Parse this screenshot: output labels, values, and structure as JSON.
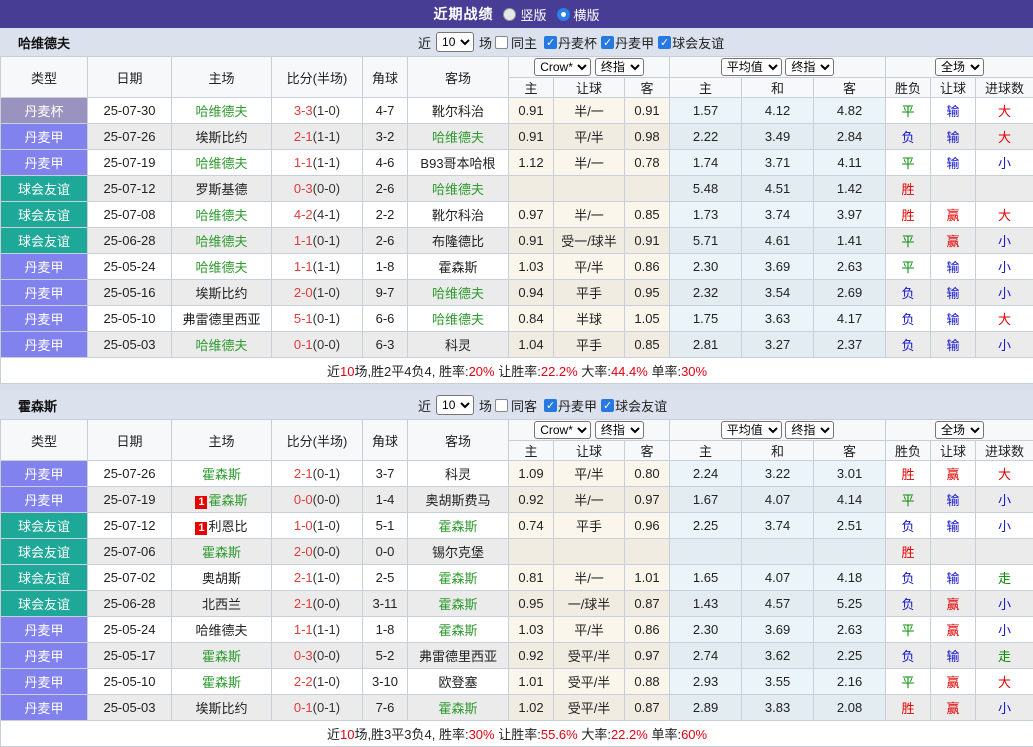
{
  "palette": {
    "topbar_bg": "#483d94",
    "team_bar_bg": "#dbe2ee",
    "type_colors": {
      "丹麦杯": "#9a93c0",
      "丹麦甲": "#8282ee",
      "球会友谊": "#1ea898"
    },
    "focus_team_green": "#2e9b2e",
    "score_red": "#e23b3b",
    "result_colors": {
      "胜": "#e60000",
      "平": "#028b02",
      "负": "#1414cc",
      "赢": "#e60000",
      "输": "#1414cc",
      "走": "#028b02",
      "大": "#e60000",
      "小": "#1414cc"
    }
  },
  "header": {
    "title": "近期战绩",
    "radios": [
      {
        "label": "竖版",
        "checked": false
      },
      {
        "label": "横版",
        "checked": true
      }
    ]
  },
  "columns": {
    "left": [
      "类型",
      "日期",
      "主场",
      "比分(半场)",
      "角球",
      "客场"
    ],
    "odds_group": {
      "select1": "Crow*",
      "select2": "终指",
      "subs": [
        "主",
        "让球",
        "客"
      ]
    },
    "avg_group": {
      "select1": "平均值",
      "select2": "终指",
      "subs": [
        "主",
        "和",
        "客"
      ]
    },
    "result_group": {
      "select": "全场",
      "subs": [
        "胜负",
        "让球",
        "进球数"
      ]
    }
  },
  "tables": [
    {
      "team": "哈维德夫",
      "filter": {
        "prefix": "近",
        "count": "10",
        "suffix": "场",
        "same_label": "同主",
        "same_checked": false,
        "leagues": [
          "丹麦杯",
          "丹麦甲",
          "球会友谊"
        ]
      },
      "rows": [
        {
          "type": "丹麦杯",
          "date": "25-07-30",
          "home": "哈维德夫",
          "home_focus": true,
          "home_badge": "",
          "score": "3-3",
          "half": "(1-0)",
          "corners": "4-7",
          "away": "靴尔科治",
          "away_focus": false,
          "away_badge": "",
          "odds": [
            "0.91",
            "半/一",
            "0.91"
          ],
          "avg": [
            "1.57",
            "4.12",
            "4.82"
          ],
          "results": [
            "平",
            "输",
            "大"
          ]
        },
        {
          "type": "丹麦甲",
          "date": "25-07-26",
          "home": "埃斯比约",
          "home_focus": false,
          "home_badge": "",
          "score": "2-1",
          "half": "(1-1)",
          "corners": "3-2",
          "away": "哈维德夫",
          "away_focus": true,
          "away_badge": "",
          "odds": [
            "0.91",
            "平/半",
            "0.98"
          ],
          "avg": [
            "2.22",
            "3.49",
            "2.84"
          ],
          "results": [
            "负",
            "输",
            "大"
          ]
        },
        {
          "type": "丹麦甲",
          "date": "25-07-19",
          "home": "哈维德夫",
          "home_focus": true,
          "home_badge": "",
          "score": "1-1",
          "half": "(1-1)",
          "corners": "4-6",
          "away": "B93哥本哈根",
          "away_focus": false,
          "away_badge": "",
          "odds": [
            "1.12",
            "半/一",
            "0.78"
          ],
          "avg": [
            "1.74",
            "3.71",
            "4.11"
          ],
          "results": [
            "平",
            "输",
            "小"
          ]
        },
        {
          "type": "球会友谊",
          "date": "25-07-12",
          "home": "罗斯基德",
          "home_focus": false,
          "home_badge": "",
          "score": "0-3",
          "half": "(0-0)",
          "corners": "2-6",
          "away": "哈维德夫",
          "away_focus": true,
          "away_badge": "",
          "odds": [
            "",
            "",
            ""
          ],
          "avg": [
            "5.48",
            "4.51",
            "1.42"
          ],
          "results": [
            "胜",
            "",
            ""
          ]
        },
        {
          "type": "球会友谊",
          "date": "25-07-08",
          "home": "哈维德夫",
          "home_focus": true,
          "home_badge": "",
          "score": "4-2",
          "half": "(4-1)",
          "corners": "2-2",
          "away": "靴尔科治",
          "away_focus": false,
          "away_badge": "",
          "odds": [
            "0.97",
            "半/一",
            "0.85"
          ],
          "avg": [
            "1.73",
            "3.74",
            "3.97"
          ],
          "results": [
            "胜",
            "赢",
            "大"
          ]
        },
        {
          "type": "球会友谊",
          "date": "25-06-28",
          "home": "哈维德夫",
          "home_focus": true,
          "home_badge": "",
          "score": "1-1",
          "half": "(0-1)",
          "corners": "2-6",
          "away": "布隆德比",
          "away_focus": false,
          "away_badge": "",
          "odds": [
            "0.91",
            "受一/球半",
            "0.91"
          ],
          "avg": [
            "5.71",
            "4.61",
            "1.41"
          ],
          "results": [
            "平",
            "赢",
            "小"
          ]
        },
        {
          "type": "丹麦甲",
          "date": "25-05-24",
          "home": "哈维德夫",
          "home_focus": true,
          "home_badge": "",
          "score": "1-1",
          "half": "(1-1)",
          "corners": "1-8",
          "away": "霍森斯",
          "away_focus": false,
          "away_badge": "",
          "odds": [
            "1.03",
            "平/半",
            "0.86"
          ],
          "avg": [
            "2.30",
            "3.69",
            "2.63"
          ],
          "results": [
            "平",
            "输",
            "小"
          ]
        },
        {
          "type": "丹麦甲",
          "date": "25-05-16",
          "home": "埃斯比约",
          "home_focus": false,
          "home_badge": "",
          "score": "2-0",
          "half": "(1-0)",
          "corners": "9-7",
          "away": "哈维德夫",
          "away_focus": true,
          "away_badge": "",
          "odds": [
            "0.94",
            "平手",
            "0.95"
          ],
          "avg": [
            "2.32",
            "3.54",
            "2.69"
          ],
          "results": [
            "负",
            "输",
            "小"
          ]
        },
        {
          "type": "丹麦甲",
          "date": "25-05-10",
          "home": "弗雷德里西亚",
          "home_focus": false,
          "home_badge": "",
          "score": "5-1",
          "half": "(0-1)",
          "corners": "6-6",
          "away": "哈维德夫",
          "away_focus": true,
          "away_badge": "",
          "odds": [
            "0.84",
            "半球",
            "1.05"
          ],
          "avg": [
            "1.75",
            "3.63",
            "4.17"
          ],
          "results": [
            "负",
            "输",
            "大"
          ]
        },
        {
          "type": "丹麦甲",
          "date": "25-05-03",
          "home": "哈维德夫",
          "home_focus": true,
          "home_badge": "",
          "score": "0-1",
          "half": "(0-0)",
          "corners": "6-3",
          "away": "科灵",
          "away_focus": false,
          "away_badge": "",
          "odds": [
            "1.04",
            "平手",
            "0.85"
          ],
          "avg": [
            "2.81",
            "3.27",
            "2.37"
          ],
          "results": [
            "负",
            "输",
            "小"
          ]
        }
      ],
      "footer": [
        {
          "t": "近",
          "c": "b"
        },
        {
          "t": "10",
          "c": "r"
        },
        {
          "t": "场,胜2平4负4, 胜率:",
          "c": "b"
        },
        {
          "t": "20%",
          "c": "r"
        },
        {
          "t": " 让胜率:",
          "c": "b"
        },
        {
          "t": "22.2%",
          "c": "r"
        },
        {
          "t": " 大率:",
          "c": "b"
        },
        {
          "t": "44.4%",
          "c": "r"
        },
        {
          "t": " 单率:",
          "c": "b"
        },
        {
          "t": "30%",
          "c": "r"
        }
      ]
    },
    {
      "team": "霍森斯",
      "filter": {
        "prefix": "近",
        "count": "10",
        "suffix": "场",
        "same_label": "同客",
        "same_checked": false,
        "leagues": [
          "丹麦甲",
          "球会友谊"
        ]
      },
      "rows": [
        {
          "type": "丹麦甲",
          "date": "25-07-26",
          "home": "霍森斯",
          "home_focus": true,
          "home_badge": "",
          "score": "2-1",
          "half": "(0-1)",
          "corners": "3-7",
          "away": "科灵",
          "away_focus": false,
          "away_badge": "",
          "odds": [
            "1.09",
            "平/半",
            "0.80"
          ],
          "avg": [
            "2.24",
            "3.22",
            "3.01"
          ],
          "results": [
            "胜",
            "赢",
            "大"
          ]
        },
        {
          "type": "丹麦甲",
          "date": "25-07-19",
          "home": "霍森斯",
          "home_focus": true,
          "home_badge": "1",
          "score": "0-0",
          "half": "(0-0)",
          "corners": "1-4",
          "away": "奥胡斯费马",
          "away_focus": false,
          "away_badge": "",
          "odds": [
            "0.92",
            "半/一",
            "0.97"
          ],
          "avg": [
            "1.67",
            "4.07",
            "4.14"
          ],
          "results": [
            "平",
            "输",
            "小"
          ]
        },
        {
          "type": "球会友谊",
          "date": "25-07-12",
          "home": "利恩比",
          "home_focus": false,
          "home_badge": "1",
          "score": "1-0",
          "half": "(1-0)",
          "corners": "5-1",
          "away": "霍森斯",
          "away_focus": true,
          "away_badge": "",
          "odds": [
            "0.74",
            "平手",
            "0.96"
          ],
          "avg": [
            "2.25",
            "3.74",
            "2.51"
          ],
          "results": [
            "负",
            "输",
            "小"
          ]
        },
        {
          "type": "球会友谊",
          "date": "25-07-06",
          "home": "霍森斯",
          "home_focus": true,
          "home_badge": "",
          "score": "2-0",
          "half": "(0-0)",
          "corners": "0-0",
          "away": "锡尔克堡",
          "away_focus": false,
          "away_badge": "",
          "odds": [
            "",
            "",
            ""
          ],
          "avg": [
            "",
            "",
            ""
          ],
          "results": [
            "胜",
            "",
            ""
          ]
        },
        {
          "type": "球会友谊",
          "date": "25-07-02",
          "home": "奥胡斯",
          "home_focus": false,
          "home_badge": "",
          "score": "2-1",
          "half": "(1-0)",
          "corners": "2-5",
          "away": "霍森斯",
          "away_focus": true,
          "away_badge": "",
          "odds": [
            "0.81",
            "半/一",
            "1.01"
          ],
          "avg": [
            "1.65",
            "4.07",
            "4.18"
          ],
          "results": [
            "负",
            "输",
            "走"
          ]
        },
        {
          "type": "球会友谊",
          "date": "25-06-28",
          "home": "北西兰",
          "home_focus": false,
          "home_badge": "",
          "score": "2-1",
          "half": "(0-0)",
          "corners": "3-11",
          "away": "霍森斯",
          "away_focus": true,
          "away_badge": "",
          "odds": [
            "0.95",
            "一/球半",
            "0.87"
          ],
          "avg": [
            "1.43",
            "4.57",
            "5.25"
          ],
          "results": [
            "负",
            "赢",
            "小"
          ]
        },
        {
          "type": "丹麦甲",
          "date": "25-05-24",
          "home": "哈维德夫",
          "home_focus": false,
          "home_badge": "",
          "score": "1-1",
          "half": "(1-1)",
          "corners": "1-8",
          "away": "霍森斯",
          "away_focus": true,
          "away_badge": "",
          "odds": [
            "1.03",
            "平/半",
            "0.86"
          ],
          "avg": [
            "2.30",
            "3.69",
            "2.63"
          ],
          "results": [
            "平",
            "赢",
            "小"
          ]
        },
        {
          "type": "丹麦甲",
          "date": "25-05-17",
          "home": "霍森斯",
          "home_focus": true,
          "home_badge": "",
          "score": "0-3",
          "half": "(0-0)",
          "corners": "5-2",
          "away": "弗雷德里西亚",
          "away_focus": false,
          "away_badge": "",
          "odds": [
            "0.92",
            "受平/半",
            "0.97"
          ],
          "avg": [
            "2.74",
            "3.62",
            "2.25"
          ],
          "results": [
            "负",
            "输",
            "走"
          ]
        },
        {
          "type": "丹麦甲",
          "date": "25-05-10",
          "home": "霍森斯",
          "home_focus": true,
          "home_badge": "",
          "score": "2-2",
          "half": "(1-0)",
          "corners": "3-10",
          "away": "欧登塞",
          "away_focus": false,
          "away_badge": "",
          "odds": [
            "1.01",
            "受平/半",
            "0.88"
          ],
          "avg": [
            "2.93",
            "3.55",
            "2.16"
          ],
          "results": [
            "平",
            "赢",
            "大"
          ]
        },
        {
          "type": "丹麦甲",
          "date": "25-05-03",
          "home": "埃斯比约",
          "home_focus": false,
          "home_badge": "",
          "score": "0-1",
          "half": "(0-1)",
          "corners": "7-6",
          "away": "霍森斯",
          "away_focus": true,
          "away_badge": "",
          "odds": [
            "1.02",
            "受平/半",
            "0.87"
          ],
          "avg": [
            "2.89",
            "3.83",
            "2.08"
          ],
          "results": [
            "胜",
            "赢",
            "小"
          ]
        }
      ],
      "footer": [
        {
          "t": "近",
          "c": "b"
        },
        {
          "t": "10",
          "c": "r"
        },
        {
          "t": "场,胜3平3负4, 胜率:",
          "c": "b"
        },
        {
          "t": "30%",
          "c": "r"
        },
        {
          "t": " 让胜率:",
          "c": "b"
        },
        {
          "t": "55.6%",
          "c": "r"
        },
        {
          "t": " 大率:",
          "c": "b"
        },
        {
          "t": "22.2%",
          "c": "r"
        },
        {
          "t": " 单率:",
          "c": "b"
        },
        {
          "t": "60%",
          "c": "r"
        }
      ]
    }
  ]
}
